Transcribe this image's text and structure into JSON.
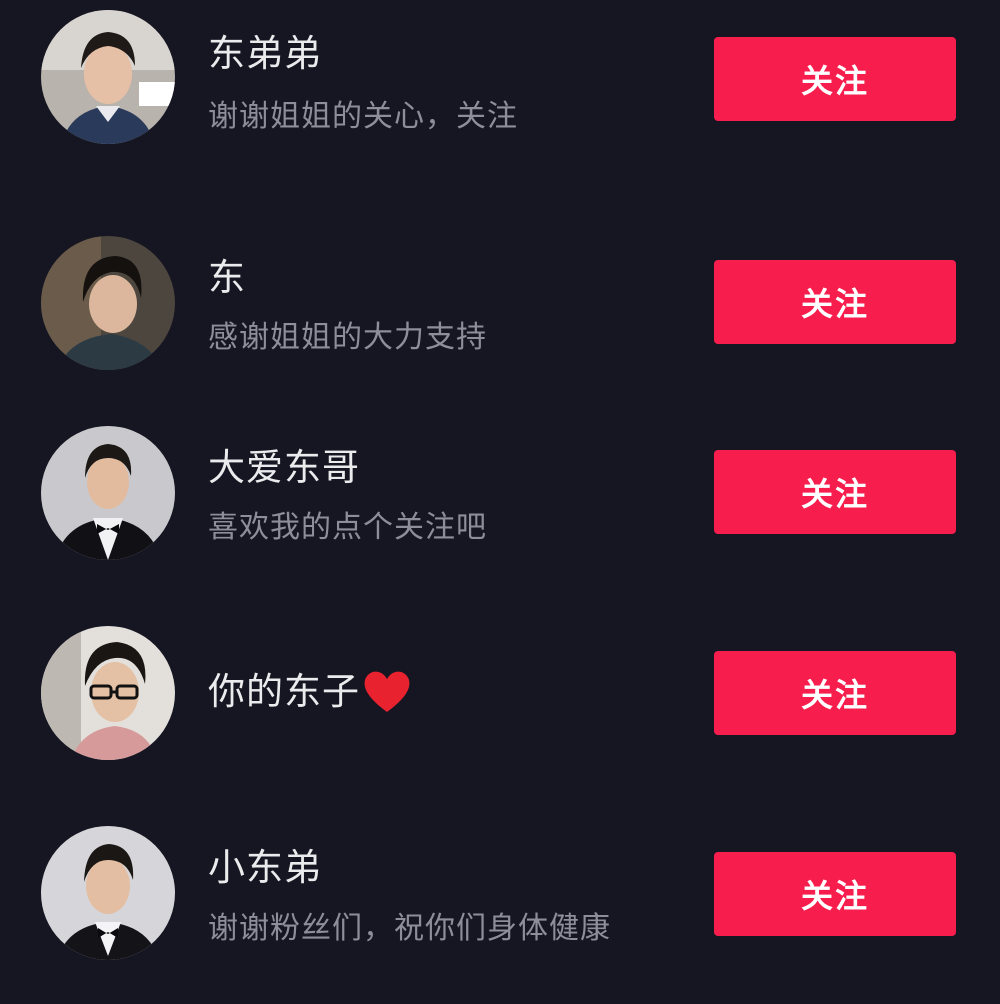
{
  "colors": {
    "background": "#161622",
    "username": "#ebebed",
    "signature": "#8d8e99",
    "follow_button": "#f71d4d",
    "heart": "#e8232f"
  },
  "users": [
    {
      "name": "东弟弟",
      "signature": "谢谢姐姐的关心，关注",
      "follow_label": "关注",
      "avatar_icon": "avatar-photo",
      "name_icon": null
    },
    {
      "name": "东",
      "signature": "感谢姐姐的大力支持",
      "follow_label": "关注",
      "avatar_icon": "avatar-photo",
      "name_icon": null
    },
    {
      "name": "大爱东哥",
      "signature": "喜欢我的点个关注吧",
      "follow_label": "关注",
      "avatar_icon": "avatar-photo",
      "name_icon": null
    },
    {
      "name": "你的东子",
      "signature": "",
      "follow_label": "关注",
      "avatar_icon": "avatar-photo",
      "name_icon": "heart-icon"
    },
    {
      "name": "小东弟",
      "signature": "谢谢粉丝们，祝你们身体健康",
      "follow_label": "关注",
      "avatar_icon": "avatar-photo",
      "name_icon": null
    }
  ]
}
